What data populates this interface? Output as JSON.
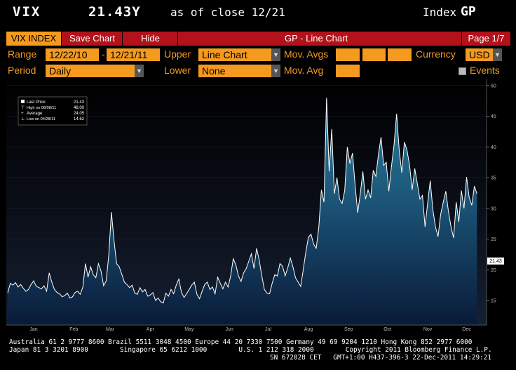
{
  "header": {
    "ticker": "VIX",
    "price": "21.43Y",
    "as_of": "as of close 12/21",
    "index_label": "Index",
    "function_code": "GP"
  },
  "toolbar": {
    "tab_vix": "VIX INDEX",
    "tab_save": "Save Chart",
    "tab_hide": "Hide",
    "title": "GP - Line Chart",
    "page": "Page 1/7"
  },
  "controls": {
    "range_label": "Range",
    "range_start": "12/22/10",
    "range_sep": "-",
    "range_end": "12/21/11",
    "upper_label": "Upper",
    "upper_value": "Line Chart",
    "movavgs_label": "Mov. Avgs",
    "currency_label": "Currency",
    "currency_value": "USD",
    "period_label": "Period",
    "period_value": "Daily",
    "lower_label": "Lower",
    "lower_value": "None",
    "movavg_label": "Mov. Avg",
    "events_label": "Events"
  },
  "legend": {
    "last_price_label": "Last Price",
    "last_price_value": "21.43",
    "high_label": "High on 08/08/11",
    "high_value": "48.00",
    "average_label": "Average",
    "average_value": "24.05",
    "low_label": "Low on 04/28/11",
    "low_value": "14.62"
  },
  "colors": {
    "accent_orange": "#f39a1f",
    "bar_red": "#b3121b",
    "line": "#ffffff",
    "area_top": "#1f6a8a",
    "area_bottom": "#0a1a33"
  },
  "chart_data": {
    "type": "area",
    "ylim": [
      11,
      51
    ],
    "yticks": [
      15,
      20,
      25,
      30,
      35,
      40,
      45,
      50
    ],
    "last_value": 21.43,
    "last_value_label": "21.43",
    "x_start_label": "010",
    "year_label": "2011",
    "month_labels": [
      {
        "label": "Jan",
        "day": 20
      },
      {
        "label": "Feb",
        "day": 51
      },
      {
        "label": "Mar",
        "day": 79
      },
      {
        "label": "Apr",
        "day": 110
      },
      {
        "label": "May",
        "day": 140
      },
      {
        "label": "Jun",
        "day": 171
      },
      {
        "label": "Jul",
        "day": 201
      },
      {
        "label": "Aug",
        "day": 232
      },
      {
        "label": "Sep",
        "day": 263
      },
      {
        "label": "Oct",
        "day": 293
      },
      {
        "label": "Nov",
        "day": 324
      },
      {
        "label": "Dec",
        "day": 354
      }
    ],
    "x_range_days": [
      0,
      364
    ],
    "series": [
      {
        "x_days": [
          0,
          2,
          4,
          6,
          8,
          10,
          12,
          14,
          16,
          18,
          20,
          22,
          24,
          26,
          28,
          30,
          32,
          34,
          36,
          38,
          40,
          42,
          44,
          46,
          48,
          50,
          52,
          54,
          56,
          58,
          60,
          62,
          64,
          66,
          68,
          70,
          72,
          74,
          76,
          78,
          80,
          82,
          84,
          86,
          88,
          90,
          92,
          94,
          96,
          98,
          100,
          102,
          104,
          106,
          108,
          110,
          112,
          114,
          116,
          118,
          120,
          122,
          124,
          126,
          128,
          130,
          132,
          134,
          136,
          138,
          140,
          142,
          144,
          146,
          148,
          150,
          152,
          154,
          156,
          158,
          160,
          162,
          164,
          166,
          168,
          170,
          172,
          174,
          176,
          178,
          180,
          182,
          184,
          186,
          188,
          190,
          192,
          194,
          196,
          198,
          200,
          202,
          204,
          206,
          208,
          210,
          212,
          214,
          216,
          218,
          220,
          222,
          224,
          226,
          228,
          230,
          232,
          234,
          236,
          238,
          240,
          242,
          244,
          246,
          248,
          250,
          252,
          254,
          256,
          258,
          260,
          262,
          264,
          266,
          268,
          270,
          272,
          274,
          276,
          278,
          280,
          282,
          284,
          286,
          288,
          290,
          292,
          294,
          296,
          298,
          300,
          302,
          304,
          306,
          308,
          310,
          312,
          314,
          316,
          318,
          320,
          322,
          324,
          326,
          328,
          330,
          332,
          334,
          336,
          338,
          340,
          342,
          344,
          346,
          348,
          350,
          352,
          354,
          356,
          358,
          360,
          362
        ],
        "values": [
          16.2,
          17.8,
          17.5,
          17.9,
          17.2,
          17.6,
          17.0,
          16.5,
          16.8,
          17.6,
          18.2,
          17.3,
          17.1,
          16.9,
          17.4,
          16.5,
          19.5,
          18.0,
          16.8,
          16.3,
          16.1,
          15.6,
          15.8,
          16.2,
          15.4,
          15.6,
          16.3,
          16.5,
          16.0,
          17.2,
          21.0,
          18.8,
          20.5,
          19.2,
          18.7,
          21.0,
          19.8,
          17.4,
          18.2,
          22.5,
          29.4,
          24.8,
          21.0,
          20.5,
          19.3,
          18.0,
          17.6,
          17.1,
          17.5,
          16.2,
          16.0,
          17.1,
          16.4,
          16.8,
          15.7,
          15.9,
          16.3,
          15.0,
          15.4,
          14.8,
          14.6,
          16.2,
          15.7,
          16.8,
          16.1,
          17.5,
          18.5,
          16.3,
          15.5,
          16.1,
          16.8,
          17.5,
          18.0,
          16.0,
          15.3,
          16.5,
          17.6,
          18.0,
          16.8,
          17.2,
          16.1,
          18.8,
          17.8,
          16.9,
          18.0,
          17.2,
          19.0,
          21.8,
          20.8,
          19.0,
          18.1,
          19.5,
          20.2,
          21.4,
          22.6,
          20.2,
          23.5,
          21.6,
          19.0,
          16.8,
          16.2,
          16.1,
          17.8,
          19.2,
          19.0,
          21.0,
          20.6,
          19.0,
          20.3,
          21.9,
          20.5,
          18.7,
          18.0,
          17.3,
          20.0,
          22.9,
          25.3,
          25.8,
          24.2,
          23.5,
          26.9,
          33.0,
          31.0,
          48.0,
          36.0,
          42.9,
          32.4,
          35.0,
          31.5,
          30.8,
          32.9,
          40.0,
          37.3,
          39.0,
          33.8,
          29.3,
          32.4,
          36.0,
          31.5,
          33.0,
          31.7,
          36.2,
          35.2,
          38.8,
          41.6,
          37.0,
          37.5,
          32.8,
          36.8,
          40.3,
          45.4,
          39.5,
          35.8,
          40.8,
          39.5,
          37.0,
          33.0,
          36.5,
          34.0,
          31.5,
          32.1,
          27.0,
          30.9,
          34.5,
          29.8,
          27.0,
          25.4,
          29.0,
          31.0,
          32.8,
          29.5,
          27.0,
          25.2,
          31.0,
          27.8,
          32.9,
          30.0,
          35.1,
          31.8,
          30.5,
          33.6,
          32.4,
          29.0,
          34.1,
          30.2,
          33.0,
          29.5,
          30.8,
          34.3,
          32.5,
          27.6,
          27.2,
          27.5,
          28.0,
          29.2,
          30.9,
          27.6,
          25.6,
          26.0,
          24.6,
          23.8,
          24.9,
          23.6,
          21.4
        ]
      }
    ]
  },
  "footer": {
    "line1": "Australia 61 2 9777 8600 Brazil 5511 3048 4500 Europe 44 20 7330 7500 Germany 49 69 9204 1210 Hong Kong 852 2977 6000",
    "line2": "Japan 81 3 3201 8900        Singapore 65 6212 1000        U.S. 1 212 318 2000        Copyright 2011 Bloomberg Finance L.P.",
    "line3": "SN 672028 CET   GMT+1:00 H437-396-3 22-Dec-2011 14:29:21"
  }
}
